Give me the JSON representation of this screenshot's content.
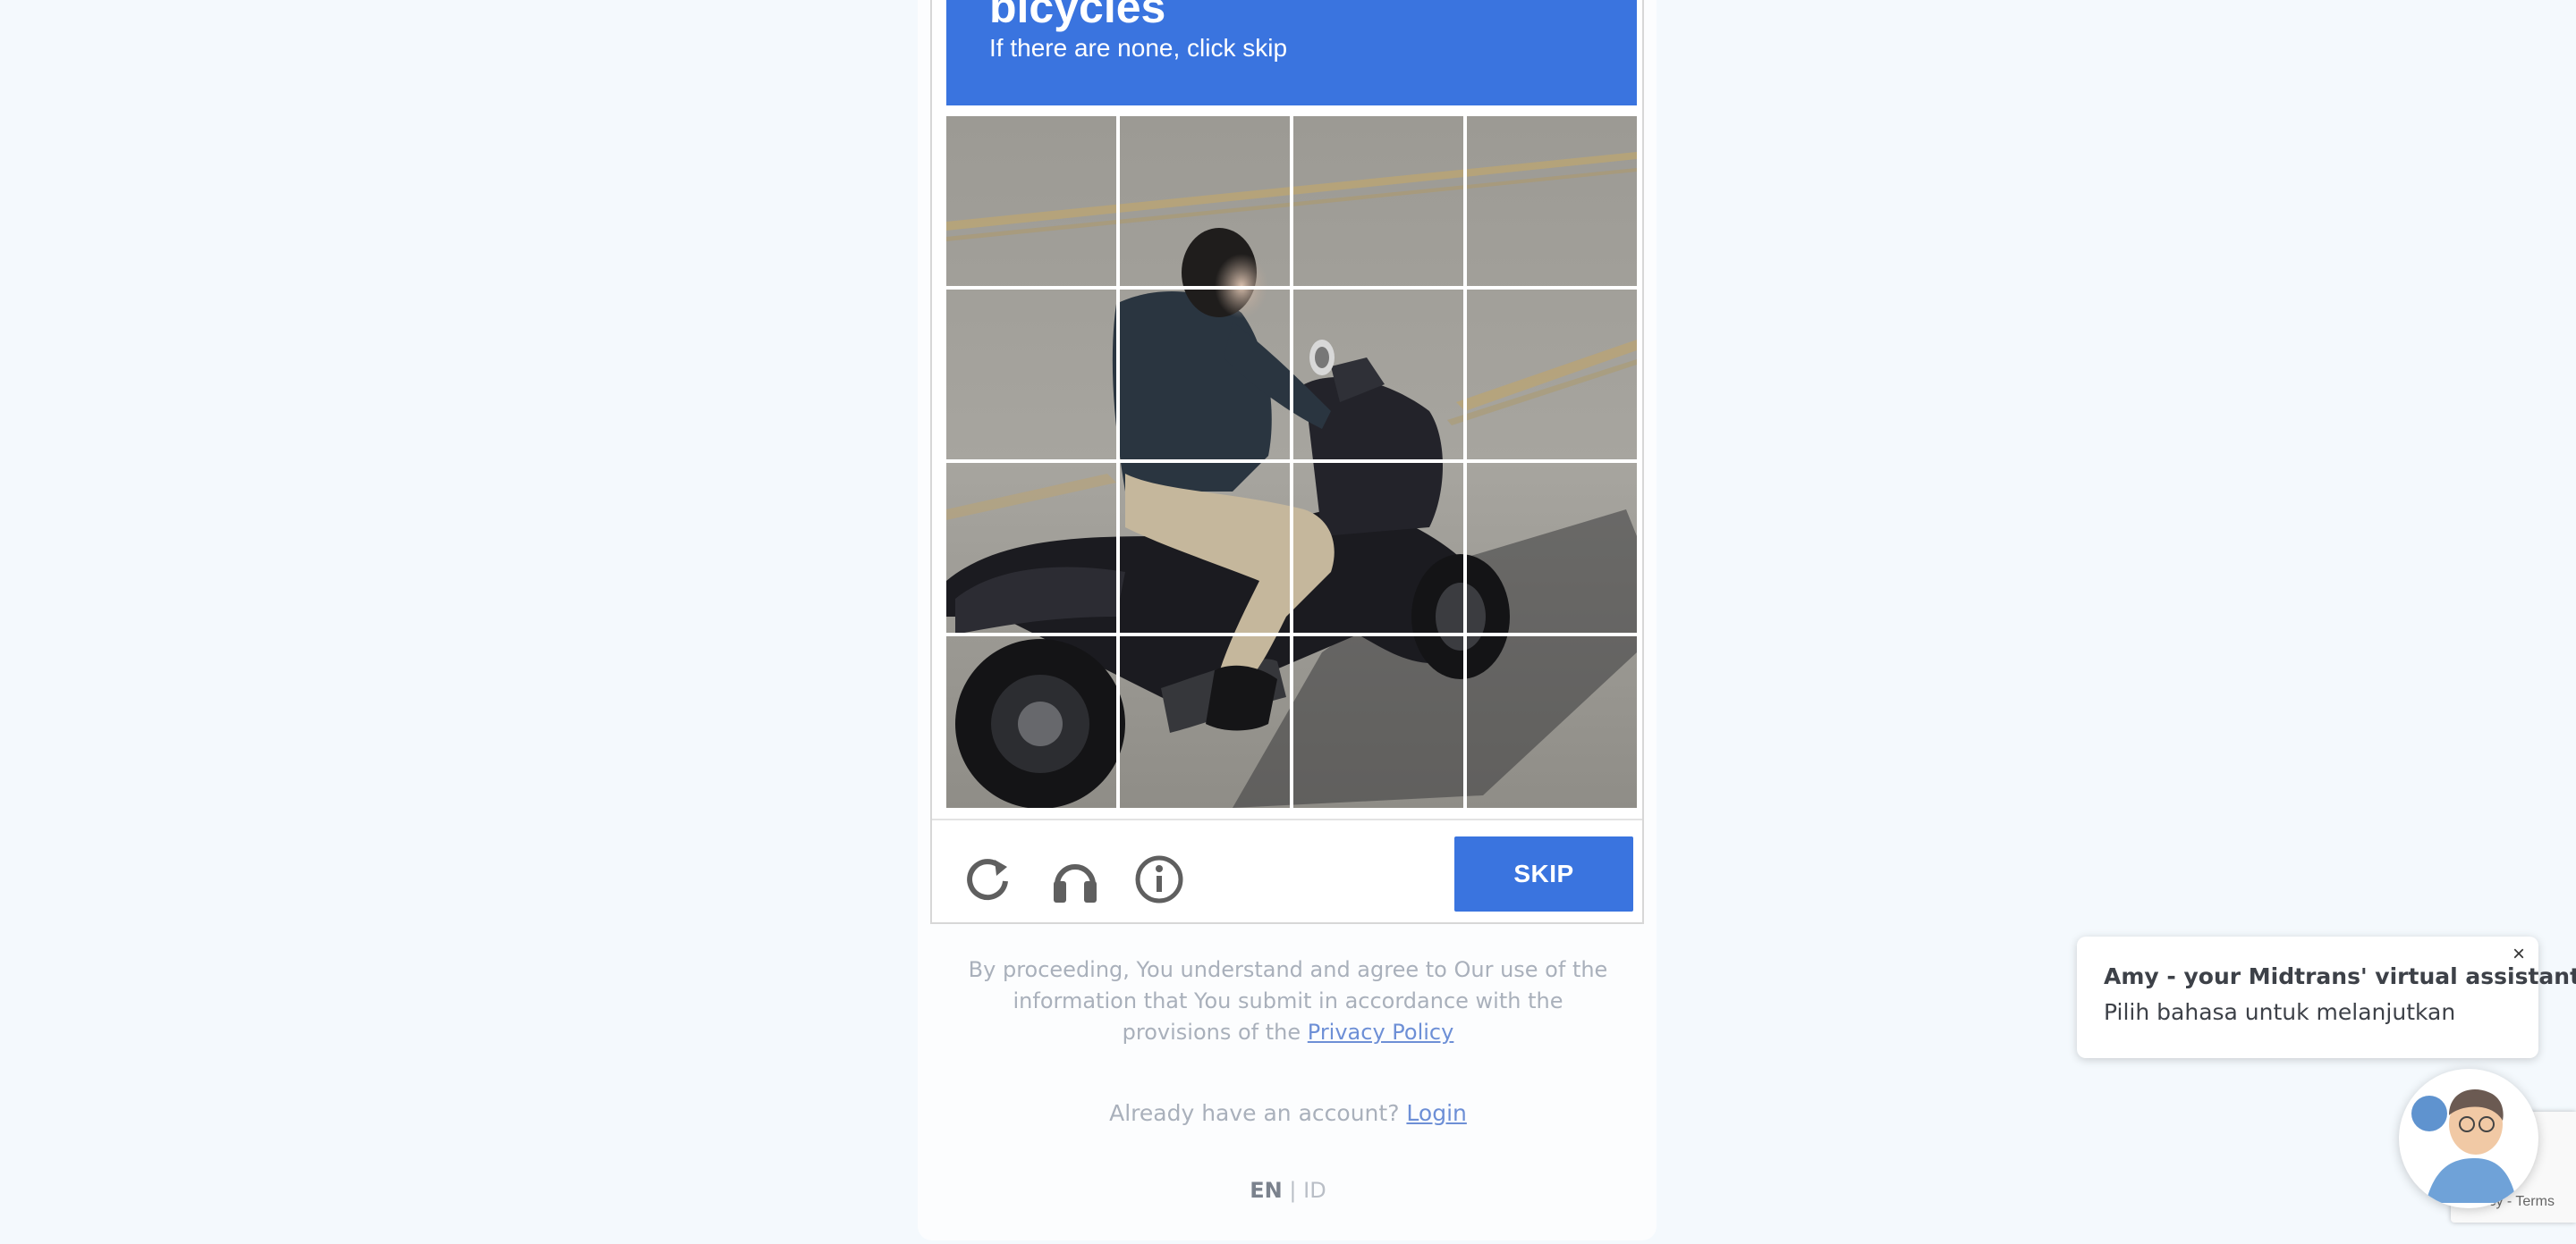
{
  "captcha": {
    "target_word": "bicycles",
    "instruction_sub": "If there are none, click skip",
    "skip_label": "SKIP",
    "icons": {
      "reload": "reload-icon",
      "audio": "headphones-icon",
      "info": "info-icon"
    },
    "accent_color": "#3a74df",
    "grid_rows": 4,
    "grid_cols": 4
  },
  "consent": {
    "text": "By proceeding, You understand and agree to Our use of the information that You submit in accordance with the provisions of the ",
    "privacy_link": "Privacy Policy"
  },
  "account": {
    "prompt": "Already have an account? ",
    "login_link": "Login"
  },
  "language": {
    "options": [
      "EN",
      "ID"
    ],
    "separator": "|",
    "selected": "EN"
  },
  "assistant": {
    "title": "Amy - your Midtrans' virtual assistant",
    "message": "Pilih bahasa untuk melanjutkan",
    "close_label": "×"
  },
  "recaptcha_badge": {
    "text": "Privacy - Terms"
  }
}
